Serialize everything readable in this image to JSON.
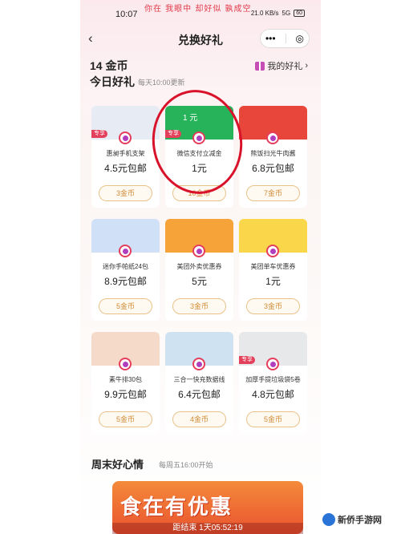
{
  "watermark": "你在 我眼中 却好似 孰成空",
  "status": {
    "time": "10:07",
    "net": "21.0 KB/s",
    "signal": "5G",
    "battery": "60"
  },
  "nav": {
    "back": "‹",
    "title": "兑换好礼",
    "menu": "•••",
    "target": "◎"
  },
  "header": {
    "coins": "14 金币",
    "my_gifts": "我的好礼",
    "arrow": "›"
  },
  "today": {
    "title": "今日好礼",
    "subtitle": "每天10:00更新"
  },
  "products": [
    {
      "badge": "专享",
      "name": "惠昶手机支架",
      "price": "4.5元包邮",
      "cost": "3金币",
      "thumb": "#e7ecf4",
      "pic": "phone-stand-icon"
    },
    {
      "badge": "专享",
      "name": "微信支付立减金",
      "price": "1元",
      "cost": "10金币",
      "thumb": "#27b35a",
      "pic": "wechat-pay-icon",
      "coupon": "1 元"
    },
    {
      "badge": "",
      "name": "熊饭扫光牛肉酱",
      "price": "6.8元包邮",
      "cost": "7金币",
      "thumb": "#e8463a",
      "pic": "beef-sauce-icon"
    },
    {
      "badge": "",
      "name": "迷你手帕纸24包",
      "price": "8.9元包邮",
      "cost": "5金币",
      "thumb": "#cfe0f7",
      "pic": "tissue-icon"
    },
    {
      "badge": "",
      "name": "美团外卖优惠券",
      "price": "5元",
      "cost": "3金币",
      "thumb": "#f6a43a",
      "pic": "meituan-food-icon"
    },
    {
      "badge": "",
      "name": "美团单车优惠券",
      "price": "1元",
      "cost": "3金币",
      "thumb": "#f9d64a",
      "pic": "bike-icon"
    },
    {
      "badge": "",
      "name": "素牛排30包",
      "price": "9.9元包邮",
      "cost": "5金币",
      "thumb": "#f5d9c9",
      "pic": "snack-icon"
    },
    {
      "badge": "",
      "name": "三合一快充数据线",
      "price": "6.4元包邮",
      "cost": "4金币",
      "thumb": "#cfe2f1",
      "pic": "cable-icon"
    },
    {
      "badge": "专享",
      "name": "加厚手提垃圾袋5卷",
      "price": "4.8元包邮",
      "cost": "5金币",
      "thumb": "#e6e8ea",
      "pic": "trash-bag-icon"
    }
  ],
  "weekend": {
    "title": "周末好心情",
    "subtitle": "每周五16:00开始"
  },
  "banner": {
    "text": "食在有优惠",
    "countdown": "距结束 1天05:52:19"
  },
  "corner": "新侨手游网"
}
